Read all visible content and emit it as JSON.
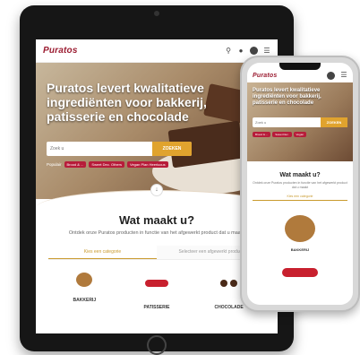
{
  "tablet": {
    "logo": "Puratos",
    "hero_title": "Puratos levert kwalitatieve ingrediënten voor bakkerij, patisserie en chocolade",
    "search_placeholder": "Zoek u",
    "search_button": "ZOEKEN",
    "popular_label": "Populair",
    "popular_tags": [
      "Brood & ...",
      "Sweet Dec. Others",
      "Vegan Plan Heerlucus"
    ],
    "section_title": "Wat maakt u?",
    "section_text": "Ontdek onze Puratos producten in functie van het afgewerkt product dat u maakt",
    "tabs": [
      "Kies een categorie",
      "Selecteer een afgewerkt product"
    ],
    "categories": [
      "BAKKERIJ",
      "PATISSERIE",
      "CHOCOLADE"
    ]
  },
  "phone": {
    "logo": "Puratos",
    "hero_title": "Puratos levert kwalitatieve ingrediënten voor bakkerij, patisserie en chocolade",
    "search_placeholder": "Zoek u",
    "search_button": "ZOEKEN",
    "popular_tags": [
      "Brood & ...",
      "Sweet Dec.",
      "Vegan"
    ],
    "section_title": "Wat maakt u?",
    "section_text": "Ontdek onze Puratos producten in functie van het afgewerkt product dat u maakt",
    "tab": "Kies een categorie",
    "category": "BAKKERIJ"
  }
}
